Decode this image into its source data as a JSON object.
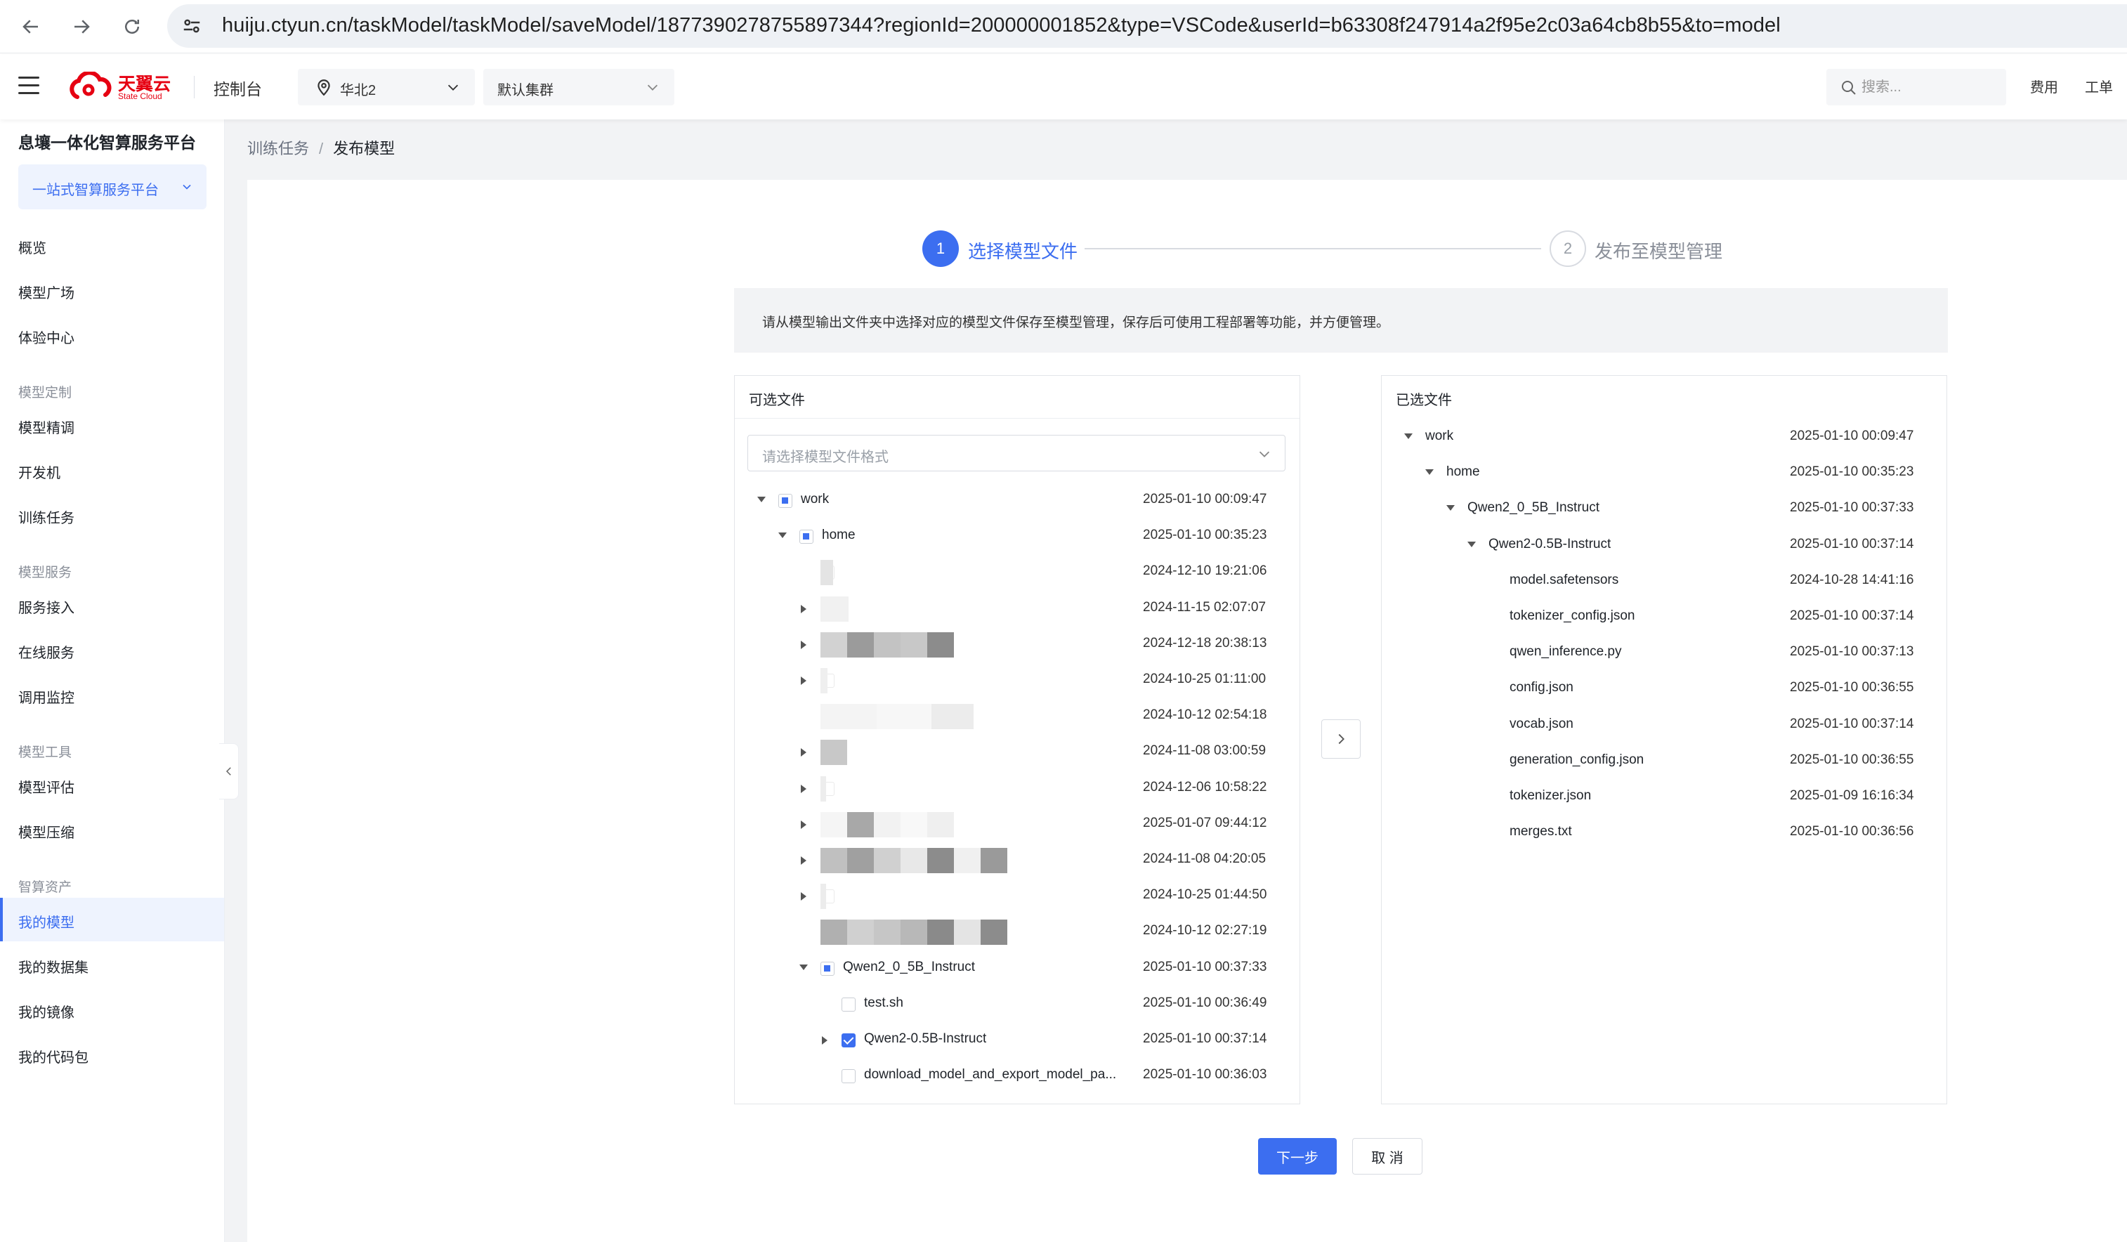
{
  "browser": {
    "url": "huiju.ctyun.cn/taskModel/taskModel/saveModel/1877390278755897344?regionId=200000001852&type=VSCode&userId=b63308f247914a2f95e2c03a64cb8b55&to=model"
  },
  "header": {
    "logo_text": "天翼云",
    "logo_sub": "State Cloud",
    "console": "控制台",
    "region": "华北2",
    "cluster": "默认集群",
    "search_placeholder": "搜索...",
    "links": [
      "费用",
      "工单"
    ]
  },
  "sidebar": {
    "platform_title": "息壤一体化智算服务平台",
    "platform_select": "一站式智算服务平台",
    "items": [
      {
        "type": "item",
        "label": "概览"
      },
      {
        "type": "item",
        "label": "模型广场"
      },
      {
        "type": "item",
        "label": "体验中心"
      },
      {
        "type": "group",
        "label": "模型定制"
      },
      {
        "type": "item",
        "label": "模型精调"
      },
      {
        "type": "item",
        "label": "开发机"
      },
      {
        "type": "item",
        "label": "训练任务"
      },
      {
        "type": "group",
        "label": "模型服务"
      },
      {
        "type": "item",
        "label": "服务接入"
      },
      {
        "type": "item",
        "label": "在线服务"
      },
      {
        "type": "item",
        "label": "调用监控"
      },
      {
        "type": "group",
        "label": "模型工具"
      },
      {
        "type": "item",
        "label": "模型评估"
      },
      {
        "type": "item",
        "label": "模型压缩"
      },
      {
        "type": "group",
        "label": "智算资产"
      },
      {
        "type": "item",
        "label": "我的模型",
        "active": true
      },
      {
        "type": "item",
        "label": "我的数据集"
      },
      {
        "type": "item",
        "label": "我的镜像"
      },
      {
        "type": "item",
        "label": "我的代码包"
      }
    ]
  },
  "breadcrumb": {
    "parent": "训练任务",
    "separator": "/",
    "current": "发布模型"
  },
  "steps": [
    {
      "num": "1",
      "label": "选择模型文件",
      "active": true
    },
    {
      "num": "2",
      "label": "发布至模型管理",
      "active": false
    }
  ],
  "info_text": "请从模型输出文件夹中选择对应的模型文件保存至模型管理，保存后可使用工程部署等功能，并方便管理。",
  "left_panel": {
    "title": "可选文件",
    "filter_placeholder": "请选择模型文件格式",
    "rows": [
      {
        "level": 0,
        "caret": "down",
        "cb": "indet",
        "name": "work",
        "time": "2025-01-10 00:09:47"
      },
      {
        "level": 1,
        "caret": "down",
        "cb": "indet",
        "name": "home",
        "time": "2025-01-10 00:35:23"
      },
      {
        "level": 2,
        "caret": "none",
        "cb": "faint",
        "name": "",
        "time": "2024-12-10 19:21:06",
        "blurred": true
      },
      {
        "level": 2,
        "caret": "right",
        "cb": "faint",
        "name": "",
        "time": "2024-11-15 02:07:07",
        "blurred": true
      },
      {
        "level": 2,
        "caret": "right",
        "cb": "faint",
        "name": "",
        "time": "2024-12-18 20:38:13",
        "blurred": true
      },
      {
        "level": 2,
        "caret": "right",
        "cb": "faint",
        "name": "",
        "time": "2024-10-25 01:11:00",
        "blurred": true
      },
      {
        "level": 2,
        "caret": "none",
        "cb": "faint",
        "name": "",
        "time": "2024-10-12 02:54:18",
        "blurred": true
      },
      {
        "level": 2,
        "caret": "right",
        "cb": "faint",
        "name": "",
        "time": "2024-11-08 03:00:59",
        "blurred": true
      },
      {
        "level": 2,
        "caret": "right",
        "cb": "faint",
        "name": "",
        "time": "2024-12-06 10:58:22",
        "blurred": true
      },
      {
        "level": 2,
        "caret": "right",
        "cb": "empty",
        "name": "",
        "time": "2025-01-07 09:44:12",
        "blurred": true
      },
      {
        "level": 2,
        "caret": "right",
        "cb": "faint",
        "name": "",
        "time": "2024-11-08 04:20:05",
        "blurred": true
      },
      {
        "level": 2,
        "caret": "right",
        "cb": "faint",
        "name": "",
        "time": "2024-10-25 01:44:50",
        "blurred": true
      },
      {
        "level": 2,
        "caret": "none",
        "cb": "faint",
        "name": "",
        "time": "2024-10-12 02:27:19",
        "blurred": true
      },
      {
        "level": 2,
        "caret": "down",
        "cb": "indet",
        "name": "Qwen2_0_5B_Instruct",
        "time": "2025-01-10 00:37:33"
      },
      {
        "level": 3,
        "caret": "none",
        "cb": "empty",
        "name": "test.sh",
        "time": "2025-01-10 00:36:49"
      },
      {
        "level": 3,
        "caret": "right",
        "cb": "checked",
        "name": "Qwen2-0.5B-Instruct",
        "time": "2025-01-10 00:37:14"
      },
      {
        "level": 3,
        "caret": "none",
        "cb": "empty",
        "name": "download_model_and_export_model_pa...",
        "time": "2025-01-10 00:36:03"
      }
    ]
  },
  "right_panel": {
    "title": "已选文件",
    "rows": [
      {
        "level": 0,
        "caret": "down",
        "name": "work",
        "time": "2025-01-10 00:09:47"
      },
      {
        "level": 1,
        "caret": "down",
        "name": "home",
        "time": "2025-01-10 00:35:23"
      },
      {
        "level": 2,
        "caret": "down",
        "name": "Qwen2_0_5B_Instruct",
        "time": "2025-01-10 00:37:33"
      },
      {
        "level": 3,
        "caret": "down",
        "name": "Qwen2-0.5B-Instruct",
        "time": "2025-01-10 00:37:14"
      },
      {
        "level": 4,
        "caret": "none",
        "name": "model.safetensors",
        "time": "2024-10-28 14:41:16"
      },
      {
        "level": 4,
        "caret": "none",
        "name": "tokenizer_config.json",
        "time": "2025-01-10 00:37:14"
      },
      {
        "level": 4,
        "caret": "none",
        "name": "qwen_inference.py",
        "time": "2025-01-10 00:37:13"
      },
      {
        "level": 4,
        "caret": "none",
        "name": "config.json",
        "time": "2025-01-10 00:36:55"
      },
      {
        "level": 4,
        "caret": "none",
        "name": "vocab.json",
        "time": "2025-01-10 00:37:14"
      },
      {
        "level": 4,
        "caret": "none",
        "name": "generation_config.json",
        "time": "2025-01-10 00:36:55"
      },
      {
        "level": 4,
        "caret": "none",
        "name": "tokenizer.json",
        "time": "2025-01-09 16:16:34"
      },
      {
        "level": 4,
        "caret": "none",
        "name": "merges.txt",
        "time": "2025-01-10 00:36:56"
      }
    ]
  },
  "buttons": {
    "next": "下一步",
    "cancel": "取 消"
  },
  "colors": {
    "primary": "#3c6ef0",
    "brand_red": "#e60012",
    "page_bg": "#f2f3f5"
  }
}
